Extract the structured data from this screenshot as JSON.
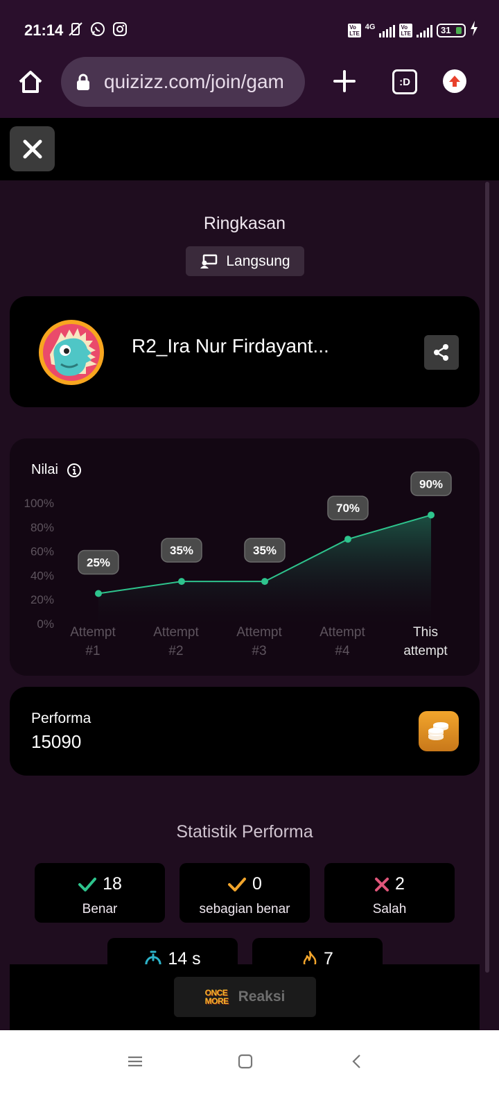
{
  "status_bar": {
    "time": "21:14",
    "icons": [
      "mute-vibrate-icon",
      "whatsapp-icon",
      "instagram-icon"
    ],
    "network": "4G",
    "battery": "31"
  },
  "browser": {
    "url": "quizizz.com/join/gam",
    "tabs_label": ":D"
  },
  "summary": {
    "title": "Ringkasan",
    "mode_label": "Langsung"
  },
  "player": {
    "name": "R2_Ira Nur Firdayant..."
  },
  "score_card": {
    "label": "Nilai"
  },
  "chart_data": {
    "type": "area",
    "ylabel": "",
    "ylim": [
      0,
      100
    ],
    "yticks": [
      "100%",
      "80%",
      "60%",
      "40%",
      "20%",
      "0%"
    ],
    "categories": [
      [
        "Attempt",
        "#1"
      ],
      [
        "Attempt",
        "#2"
      ],
      [
        "Attempt",
        "#3"
      ],
      [
        "Attempt",
        "#4"
      ],
      [
        "This",
        "attempt"
      ]
    ],
    "values": [
      25,
      35,
      35,
      70,
      90
    ],
    "value_labels": [
      "25%",
      "35%",
      "35%",
      "70%",
      "90%"
    ],
    "colors": {
      "line": "#2ec48d",
      "fill": "#1a4a3c"
    }
  },
  "performance": {
    "label": "Performa",
    "value": "15090"
  },
  "stats": {
    "title": "Statistik Performa",
    "items": [
      {
        "value": "18",
        "label": "Benar",
        "icon": "check-icon",
        "color": "#2ec48d"
      },
      {
        "value": "0",
        "label": "sebagian benar",
        "icon": "check-icon",
        "color": "#f2a52c"
      },
      {
        "value": "2",
        "label": "Salah",
        "icon": "cross-icon",
        "color": "#e0567a"
      },
      {
        "value": "14 s",
        "label": "",
        "icon": "stopwatch-icon",
        "color": "#2db3c9"
      },
      {
        "value": "7",
        "label": "",
        "icon": "streak-flame-icon",
        "color": "#f2a52c"
      }
    ]
  },
  "reaction": {
    "logo_line1": "ONCE",
    "logo_line2": "MORE",
    "label": "Reaksi"
  }
}
